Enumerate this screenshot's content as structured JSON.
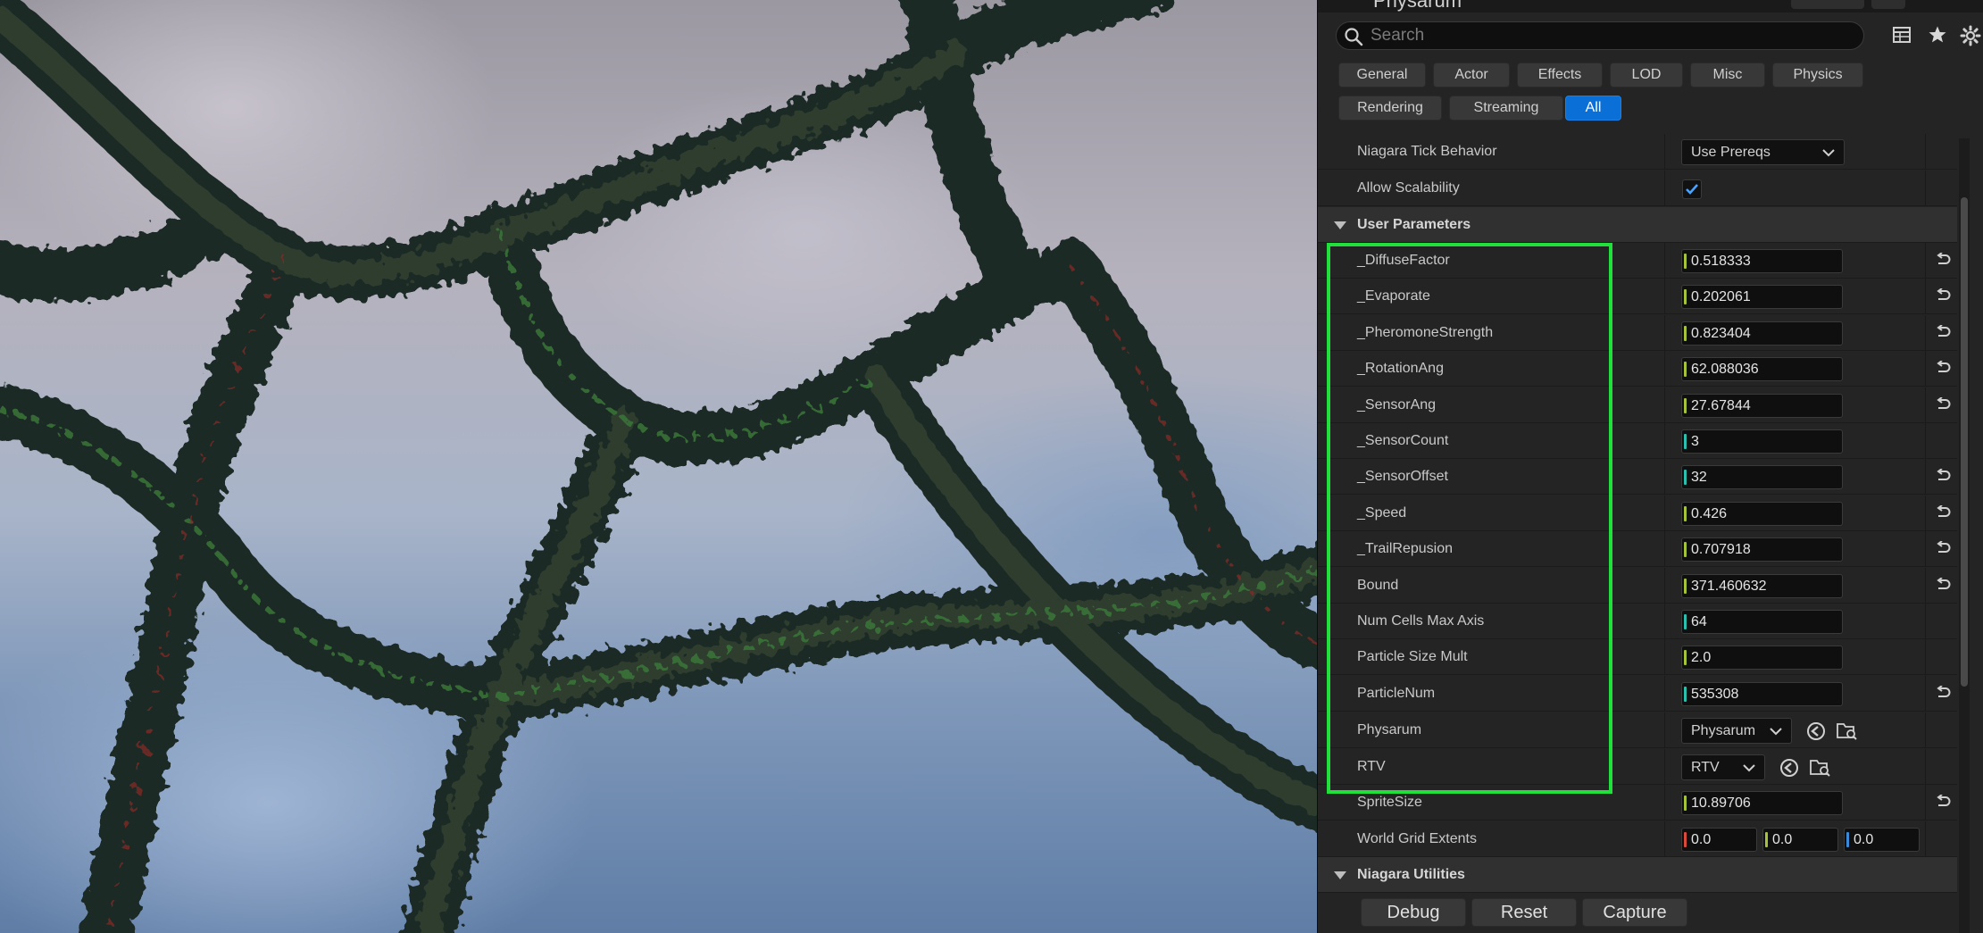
{
  "window": {
    "title": "Physarum"
  },
  "search": {
    "placeholder": "Search"
  },
  "filters": [
    {
      "label": "General"
    },
    {
      "label": "Actor"
    },
    {
      "label": "Effects"
    },
    {
      "label": "LOD"
    },
    {
      "label": "Misc"
    },
    {
      "label": "Physics"
    },
    {
      "label": "Rendering"
    },
    {
      "label": "Streaming"
    },
    {
      "label": "All",
      "active": true
    }
  ],
  "top_props": {
    "tick_behavior": {
      "label": "Niagara Tick Behavior",
      "value": "Use Prereqs"
    },
    "allow_scalability": {
      "label": "Allow Scalability",
      "checked": true
    }
  },
  "user_parameters": {
    "title": "User Parameters",
    "params": [
      {
        "label": "_DiffuseFactor",
        "value": "0.518333"
      },
      {
        "label": "_Evaporate",
        "value": "0.202061"
      },
      {
        "label": "_PheromoneStrength",
        "value": "0.823404"
      },
      {
        "label": "_RotationAng",
        "value": "62.088036"
      },
      {
        "label": "_SensorAng",
        "value": "27.67844"
      },
      {
        "label": "_SensorCount",
        "value": "3"
      },
      {
        "label": "_SensorOffset",
        "value": "32"
      },
      {
        "label": "_Speed",
        "value": "0.426"
      },
      {
        "label": "_TrailRepusion",
        "value": "0.707918"
      },
      {
        "label": "Bound",
        "value": "371.460632"
      },
      {
        "label": "Num Cells Max Axis",
        "value": "64"
      },
      {
        "label": "Particle Size Mult",
        "value": "2.0"
      },
      {
        "label": "ParticleNum",
        "value": "535308"
      }
    ],
    "physarum": {
      "label": "Physarum",
      "value": "Physarum"
    },
    "rtv": {
      "label": "RTV",
      "value": "RTV"
    },
    "sprite_size": {
      "label": "SpriteSize",
      "value": "10.89706"
    },
    "world_grid": {
      "label": "World Grid Extents",
      "x": "0.0",
      "y": "0.0",
      "z": "0.0"
    }
  },
  "utilities": {
    "title": "Niagara Utilities",
    "debug": "Debug",
    "reset": "Reset",
    "capture": "Capture"
  },
  "colors": {
    "accent": "#0a70d8",
    "highlight": "#22e03c",
    "panel_bg": "#242424"
  },
  "icons": [
    "search-icon",
    "table-icon",
    "star-icon",
    "gear-icon",
    "reset-arrow-icon",
    "browse-back-icon",
    "browse-folder-icon",
    "chevron-down-icon",
    "checkmark-icon"
  ]
}
